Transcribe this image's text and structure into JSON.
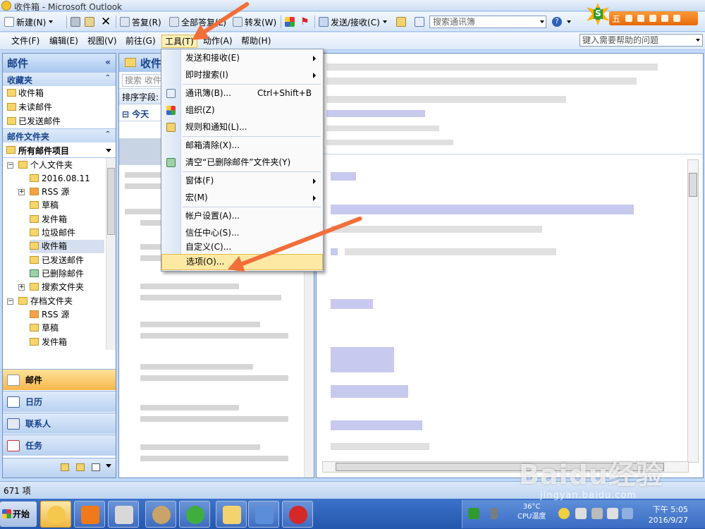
{
  "window": {
    "title": "收件箱 - Microsoft Outlook"
  },
  "toolbar": {
    "new_label": "新建(N)",
    "reply_label": "答复(R)",
    "reply_all_label": "全部答复(L)",
    "forward_label": "转发(W)",
    "send_receive_label": "发送/接收(C)",
    "address_search_placeholder": "搜索通讯簿"
  },
  "ime": {
    "mode_label": "五"
  },
  "menubar": {
    "items": [
      "文件(F)",
      "编辑(E)",
      "视图(V)",
      "前往(G)",
      "工具(T)",
      "动作(A)",
      "帮助(H)"
    ],
    "help_placeholder": "键入需要帮助的问题"
  },
  "nav": {
    "title": "邮件",
    "favorites_title": "收藏夹",
    "favorites": [
      "收件箱",
      "未读邮件",
      "已发送邮件"
    ],
    "mail_folders_title": "邮件文件夹",
    "all_mail_items": "所有邮件项目",
    "tree": [
      "个人文件夹",
      "2016.08.11",
      "RSS 源",
      "草稿",
      "发件箱",
      "垃圾邮件",
      "收件箱",
      "已发送邮件",
      "已删除邮件",
      "搜索文件夹",
      "存档文件夹",
      "RSS 源",
      "草稿",
      "发件箱"
    ],
    "modules": [
      "邮件",
      "日历",
      "联系人",
      "任务"
    ]
  },
  "list": {
    "title": "收件箱",
    "search_placeholder": "搜索 收件箱",
    "sort_label": "排序字段:",
    "group_today": "今天"
  },
  "tools_menu": {
    "items": [
      {
        "label": "发送和接收(E)",
        "submenu": true
      },
      {
        "label": "即时搜索(I)",
        "submenu": true
      },
      {
        "label": "通讯簿(B)...",
        "shortcut": "Ctrl+Shift+B"
      },
      {
        "label": "组织(Z)"
      },
      {
        "label": "规则和通知(L)..."
      },
      {
        "label": "邮箱清除(X)..."
      },
      {
        "label": "清空“已删除邮件”文件夹(Y)"
      },
      {
        "label": "窗体(F)",
        "submenu": true
      },
      {
        "label": "宏(M)",
        "submenu": true
      },
      {
        "label": "帐户设置(A)..."
      },
      {
        "label": "信任中心(S)..."
      },
      {
        "label": "自定义(C)..."
      },
      {
        "label": "选项(O)...",
        "highlighted": true
      }
    ]
  },
  "status": {
    "item_count": "671 项"
  },
  "taskbar": {
    "start_label": "开始",
    "cpu_temp": "36°C",
    "cpu_label": "CPU温度",
    "time": "下午 5:05",
    "date": "2016/9/27"
  },
  "watermark": {
    "text": "Baidu经验",
    "url": "jingyan.baidu.com"
  },
  "colors": {
    "accent": "#f26f3a",
    "menu_highlight": "#fde9a4",
    "outlook_blue": "#15428b"
  }
}
